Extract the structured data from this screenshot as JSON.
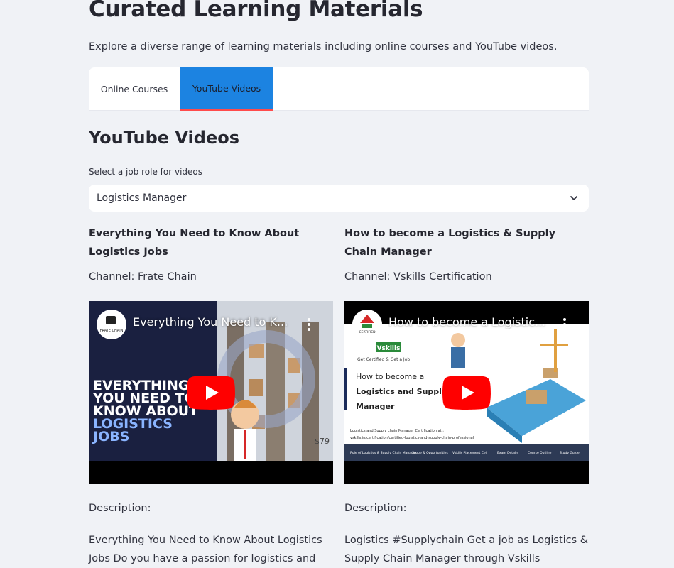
{
  "page": {
    "title": "Curated Learning Materials",
    "intro": "Explore a diverse range of learning materials including online courses and YouTube videos."
  },
  "tabs": [
    {
      "label": "Online Courses",
      "active": false
    },
    {
      "label": "YouTube Videos",
      "active": true
    }
  ],
  "section": {
    "title": "YouTube Videos",
    "select_label": "Select a job role for videos",
    "select_value": "Logistics Manager"
  },
  "videos": [
    {
      "title": "Everything You Need to Know About Logistics Jobs",
      "channel": "Channel: Frate Chain",
      "player_title": "Everything You Need to K...",
      "avatar_text": "FRATE CHAIN",
      "thumb_lines": [
        "EVERYTHING",
        "YOU NEED TO",
        "KNOW ABOUT",
        "LOGISTICS",
        "JOBS"
      ],
      "price_tag": "$79",
      "description_label": "Description:",
      "description": "Everything You Need to Know About Logistics Jobs Do you have a passion for logistics and"
    },
    {
      "title": "How to become a Logistics & Supply Chain Manager",
      "channel": "Channel: Vskills Certification",
      "player_title": "How to become a Logistic...",
      "avatar_text": "CERTIFIED",
      "brand": "Vskills",
      "tagline": "Get Certified & Get a Job",
      "thumb_lines": [
        "How to become a",
        "Logistics and Supply c",
        "Manager"
      ],
      "cert_line": "Logistics and Supply chain Manager Certification at :",
      "cert_url": "vskills.in/certification/certified-logistics-and-supply-chain-professional",
      "footer_items": [
        "Role of Logistics & Supply Chain Manager",
        "Scope & Opportunities",
        "Vskills Placement Cell",
        "Exam Details",
        "Course Outline",
        "Study Guide"
      ],
      "description_label": "Description:",
      "description": "Logistics #Supplychain Get a job as Logistics & Supply Chain Manager through Vskills Placements"
    }
  ],
  "colors": {
    "background": "#f0f2f6",
    "active_tab": "#1c83e1",
    "tab_underline": "#ff4b4b",
    "play_red": "#ff0000"
  }
}
